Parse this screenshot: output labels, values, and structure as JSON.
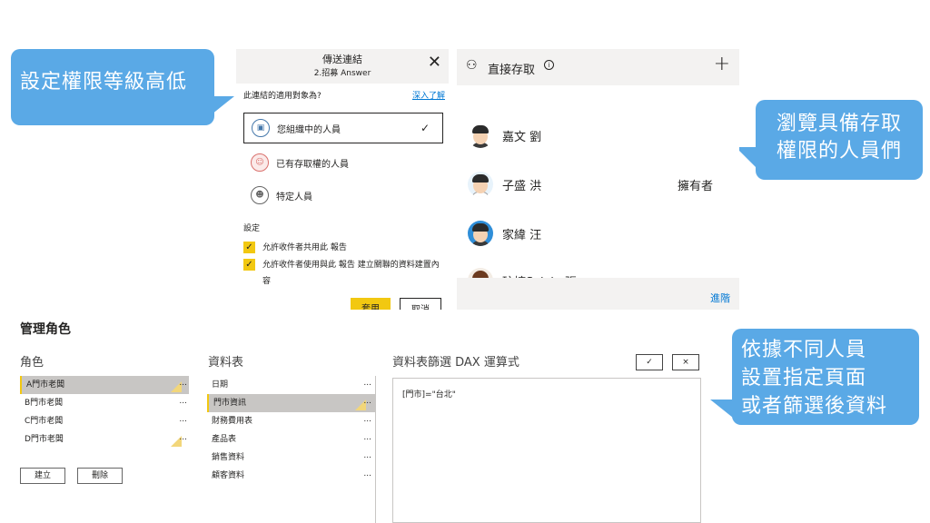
{
  "callouts": {
    "permission_level": "設定權限等級高低",
    "browse_access_line1": "瀏覽具備存取",
    "browse_access_line2": "權限的人員們",
    "filter_line1": "依據不同人員",
    "filter_line2": "設置指定頁面",
    "filter_line3": "或者篩選後資料"
  },
  "share_link": {
    "title": "傳送連結",
    "subtitle": "2.招募 Answer",
    "close_icon": "close-icon",
    "question": "此連結的適用對象為?",
    "learn_more": "深入了解",
    "options": [
      {
        "label": "您組織中的人員",
        "selected": true,
        "icon": "org-icon"
      },
      {
        "label": "已有存取權的人員",
        "selected": false,
        "icon": "people-icon"
      },
      {
        "label": "特定人員",
        "selected": false,
        "icon": "person-icon"
      }
    ],
    "settings_label": "設定",
    "checkboxes": [
      {
        "label": "允許收件者共用此 報告",
        "checked": true
      },
      {
        "label": "允許收件者使用與此 報告 建立關聯的資料建置內容",
        "checked": true
      }
    ],
    "apply_label": "套用",
    "cancel_label": "取消"
  },
  "direct_access": {
    "title": "直接存取",
    "people": [
      {
        "name": "嘉文 劉",
        "role": ""
      },
      {
        "name": "子盛 洪",
        "role": "擁有者"
      },
      {
        "name": "家緯 汪",
        "role": ""
      },
      {
        "name": "玟婷Sylvia 張",
        "role": ""
      }
    ],
    "advanced_label": "進階"
  },
  "manage_roles": {
    "title": "管理角色",
    "roles_header": "角色",
    "tables_header": "資料表",
    "dax_header": "資料表篩選 DAX 運算式",
    "roles": [
      {
        "label": "A門市老闆",
        "selected": true,
        "filtered": true
      },
      {
        "label": "B門市老闆",
        "selected": false,
        "filtered": false
      },
      {
        "label": "C門市老闆",
        "selected": false,
        "filtered": false
      },
      {
        "label": "D門市老闆",
        "selected": false,
        "filtered": true
      }
    ],
    "create_label": "建立",
    "delete_label": "刪除",
    "tables": [
      {
        "label": "日期",
        "selected": false,
        "filtered": false
      },
      {
        "label": "門市資訊",
        "selected": true,
        "filtered": true
      },
      {
        "label": "財務費用表",
        "selected": false,
        "filtered": false
      },
      {
        "label": "產品表",
        "selected": false,
        "filtered": false
      },
      {
        "label": "銷售資料",
        "selected": false,
        "filtered": false
      },
      {
        "label": "顧客資料",
        "selected": false,
        "filtered": false
      }
    ],
    "dax_expression": "[門市]=\"台北\"",
    "ok_symbol": "✓",
    "cancel_symbol": "×",
    "dots": "..."
  },
  "colors": {
    "accent_yellow": "#f2c811",
    "callout_blue": "#5aa9e6",
    "link_blue": "#0078d4"
  }
}
